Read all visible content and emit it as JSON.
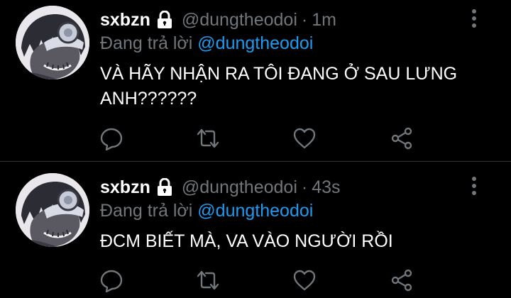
{
  "tweets": [
    {
      "display_name": "sxbzn",
      "handle": "@dungtheodoi",
      "separator": "·",
      "time": "1m",
      "reply_prefix": "Đang trả lời",
      "reply_target": "@dungtheodoi",
      "text": "VÀ HÃY NHẬN RA TÔI ĐANG Ở SAU LƯNG ANH??????"
    },
    {
      "display_name": "sxbzn",
      "handle": "@dungtheodoi",
      "separator": "·",
      "time": "43s",
      "reply_prefix": "Đang trả lời",
      "reply_target": "@dungtheodoi",
      "text": "ĐCM BIẾT MÀ, VA VÀO NGƯỜI RỒI"
    }
  ],
  "icons": {
    "verified_lock": "lock-icon",
    "more": "more-vertical-icon",
    "reply": "reply-bubble-icon",
    "retweet": "retweet-icon",
    "like": "heart-icon",
    "share": "share-icon"
  },
  "colors": {
    "background": "#000000",
    "primary_text": "#ffffff",
    "secondary_text": "#71767b",
    "link": "#1d9bf0",
    "divider": "#2f3336"
  }
}
